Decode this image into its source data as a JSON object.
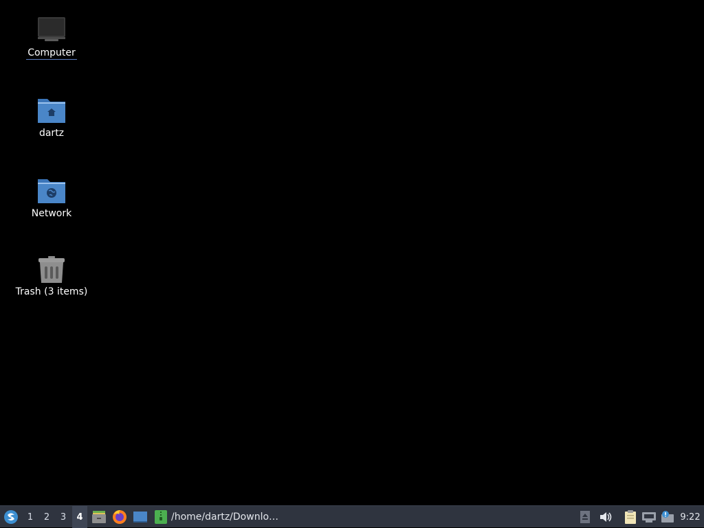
{
  "desktop": {
    "icons": [
      {
        "label": "Computer",
        "icon": "computer-icon",
        "selected": true
      },
      {
        "label": "dartz",
        "icon": "home-folder-icon",
        "selected": false
      },
      {
        "label": "Network",
        "icon": "network-folder-icon",
        "selected": false
      },
      {
        "label": "Trash (3 items)",
        "icon": "trash-icon",
        "selected": false
      }
    ]
  },
  "taskbar": {
    "menu_icon": "menu-icon",
    "workspaces": [
      "1",
      "2",
      "3",
      "4"
    ],
    "active_workspace": "4",
    "launchers": [
      "file-manager-icon",
      "firefox-icon",
      "desktop-icon"
    ],
    "task": {
      "icon": "archive-manager-icon",
      "title": "/home/dartz/Downlo…"
    },
    "tray": [
      "eject-icon",
      "volume-icon",
      "clipboard-icon",
      "network-wired-icon",
      "updates-icon"
    ],
    "clock": "9:22"
  },
  "colors": {
    "desktop_bg": "#000000",
    "panel_bg": "#2f343f",
    "folder_blue": "#4a86c8",
    "selection_underline": "#5e7fc4"
  }
}
